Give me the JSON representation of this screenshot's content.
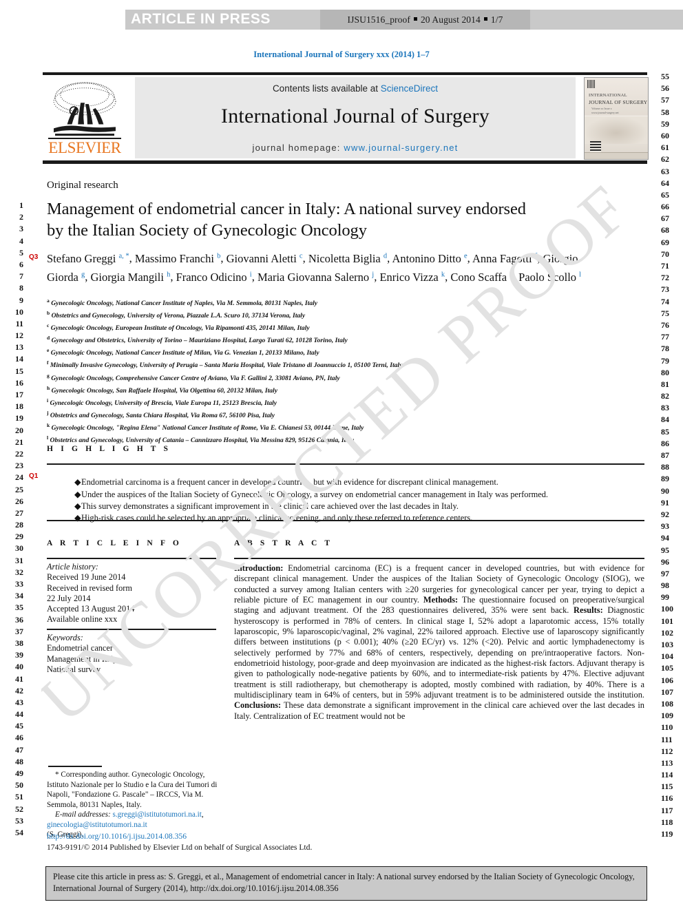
{
  "press_banner": {
    "label": "ARTICLE IN PRESS",
    "proof_prefix": "IJSU1516_proof",
    "proof_date": "20 August 2014",
    "proof_page": "1/7"
  },
  "journal_ref": "International Journal of Surgery xxx (2014) 1–7",
  "masthead": {
    "contents_prefix": "Contents lists available at ",
    "sciencedirect": "ScienceDirect",
    "journal_title": "International Journal of Surgery",
    "homepage_label": "journal homepage: ",
    "homepage_url": "www.journal-surgery.net",
    "publisher": "ELSEVIER",
    "cover": {
      "line1": "INTERNATIONAL",
      "line2": "JOURNAL OF SURGERY",
      "line3": "Volume xx  Issue x",
      "line4": "www.journal-surgery.net"
    }
  },
  "article": {
    "section_label": "Original research",
    "title": "Management of endometrial cancer in Italy: A national survey endorsed by the Italian Society of Gynecologic Oncology",
    "query_marker_authors": "Q3",
    "query_marker_highlights": "Q1",
    "authors": [
      {
        "name": "Stefano Greggi",
        "sup": "a, *"
      },
      {
        "name": "Massimo Franchi",
        "sup": "b"
      },
      {
        "name": "Giovanni Aletti",
        "sup": "c"
      },
      {
        "name": "Nicoletta Biglia",
        "sup": "d"
      },
      {
        "name": "Antonino Ditto",
        "sup": "e"
      },
      {
        "name": "Anna Fagotti",
        "sup": "f"
      },
      {
        "name": "Giorgio Giorda",
        "sup": "g"
      },
      {
        "name": "Giorgia Mangili",
        "sup": "h"
      },
      {
        "name": "Franco Odicino",
        "sup": "i"
      },
      {
        "name": "Maria Giovanna Salerno",
        "sup": "j"
      },
      {
        "name": "Enrico Vizza",
        "sup": "k"
      },
      {
        "name": "Cono Scaffa",
        "sup": "a"
      },
      {
        "name": "Paolo Scollo",
        "sup": "l"
      }
    ],
    "affiliations": [
      {
        "mark": "a",
        "text": "Gynecologic Oncology, National Cancer Institute of Naples, Via M. Semmola, 80131 Naples, Italy"
      },
      {
        "mark": "b",
        "text": "Obstetrics and Gynecology, University of Verona, Piazzale L.A. Scuro 10, 37134 Verona, Italy"
      },
      {
        "mark": "c",
        "text": "Gynecologic Oncology, European Institute of Oncology, Via Ripamonti 435, 20141 Milan, Italy"
      },
      {
        "mark": "d",
        "text": "Gynecology and Obstetrics, University of Torino – Mauriziano Hospital, Largo Turati 62, 10128 Torino, Italy"
      },
      {
        "mark": "e",
        "text": "Gynecologic Oncology, National Cancer Institute of Milan, Via G. Venezian 1, 20133 Milano, Italy"
      },
      {
        "mark": "f",
        "text": "Minimally Invasive Gynecology, University of Perugia – Santa Maria Hospital, Viale Tristano di Joannuccio 1, 05100 Terni, Italy"
      },
      {
        "mark": "g",
        "text": "Gynecologic Oncology, Comprehensive Cancer Centre of Aviano, Via F. Gallini 2, 33081 Aviano, PN, Italy"
      },
      {
        "mark": "h",
        "text": "Gynecologic Oncology, San Raffaele Hospital, Via Olgettina 60, 20132 Milan, Italy"
      },
      {
        "mark": "i",
        "text": "Gynecologic Oncology, University of Brescia, Viale Europa 11, 25123 Brescia, Italy"
      },
      {
        "mark": "j",
        "text": "Obstetrics and Gynecology, Santa Chiara Hospital, Via Roma 67, 56100 Pisa, Italy"
      },
      {
        "mark": "k",
        "text": "Gynecologic Oncology, \"Regina Elena\" National Cancer Institute of Rome, Via E. Chianesi 53, 00144 Rome, Italy"
      },
      {
        "mark": "l",
        "text": "Obstetrics and Gynecology, University of Catania – Cannizzaro Hospital, Via Messina 829, 95126 Catania, Italy"
      }
    ]
  },
  "highlights": {
    "heading": "H I G H L I G H T S",
    "items": [
      "Endometrial carcinoma is a frequent cancer in developed countries, but with evidence for discrepant clinical management.",
      "Under the auspices of the Italian Society of Gynecologic Oncology, a survey on endometrial cancer management in Italy was performed.",
      "This survey demonstrates a significant improvement in the clinical care achieved over the last decades in Italy.",
      "High-risk cases could be selected by an appropriate clinical screening, and only these referred to reference centers."
    ]
  },
  "article_info": {
    "heading": "A R T I C L E   I N F O",
    "history_label": "Article history:",
    "history": [
      "Received 19 June 2014",
      "Received in revised form",
      "22 July 2014",
      "Accepted 13 August 2014",
      "Available online xxx"
    ],
    "keywords_label": "Keywords:",
    "keywords": [
      "Endometrial cancer",
      "Management in Italy",
      "National survey"
    ]
  },
  "abstract": {
    "heading": "A B S T R A C T",
    "introduction_label": "Introduction:",
    "introduction": " Endometrial carcinoma (EC) is a frequent cancer in developed countries, but with evidence for discrepant clinical management. Under the auspices of the Italian Society of Gynecologic Oncology (SIOG), we conducted a survey among Italian centers with ≥20 surgeries for gynecological cancer per year, trying to depict a reliable picture of EC management in our country. ",
    "methods_label": "Methods:",
    "methods": " The questionnaire focused on preoperative/surgical staging and adjuvant treatment. Of the 283 questionnaires delivered, 35% were sent back. ",
    "results_label": "Results:",
    "results": " Diagnostic hysteroscopy is performed in 78% of centers. In clinical stage I, 52% adopt a laparotomic access, 15% totally laparoscopic, 9% laparoscopic/vaginal, 2% vaginal, 22% tailored approach. Elective use of laparoscopy significantly differs between institutions (p < 0.001); 40% (≥20 EC/yr) vs. 12% (<20). Pelvic and aortic lymphadenectomy is selectively performed by 77% and 68% of centers, respectively, depending on pre/intraoperative factors. Non-endometrioid histology, poor-grade and deep myoinvasion are indicated as the highest-risk factors. Adjuvant therapy is given to pathologically node-negative patients by 60%, and to intermediate-risk patients by 47%. Elective adjuvant treatment is still radiotherapy, but chemotherapy is adopted, mostly combined with radiation, by 40%. There is a multidisciplinary team in 64% of centers, but in 59% adjuvant treatment is to be administered outside the institution. ",
    "conclusions_label": "Conclusions:",
    "conclusions": " These data demonstrate a significant improvement in the clinical care achieved over the last decades in Italy. Centralization of EC treatment would not be"
  },
  "footnote": {
    "corresponding": "* Corresponding author. Gynecologic Oncology, Istituto Nazionale per lo Studio e la Cura dei Tumori di Napoli, \"Fondazione G. Pascale\" – IRCCS, Via M. Semmola, 80131 Naples, Italy.",
    "email_label": "E-mail addresses:",
    "email1": "s.greggi@istitutotumori.na.it",
    "email2": "ginecologia@istitutotumori.na.it",
    "email_suffix": "(S. Greggi).",
    "doi": "http://dx.doi.org/10.1016/j.ijsu.2014.08.356",
    "copyright": "1743-9191/© 2014 Published by Elsevier Ltd on behalf of Surgical Associates Ltd."
  },
  "cite_box": "Please cite this article in press as: S. Greggi, et al., Management of endometrial cancer in Italy: A national survey endorsed by the Italian Society of Gynecologic Oncology, International Journal of Surgery (2014), http://dx.doi.org/10.1016/j.ijsu.2014.08.356",
  "watermark": "UNCORRECTED PROOF",
  "line_numbers": {
    "left_start": 1,
    "left_end": 54,
    "right_start": 55,
    "right_end": 119
  },
  "colors": {
    "link": "#1b75bb",
    "query": "#cc0000",
    "elsevier_orange": "#e87722",
    "banner_gray": "#c9c9c9"
  }
}
